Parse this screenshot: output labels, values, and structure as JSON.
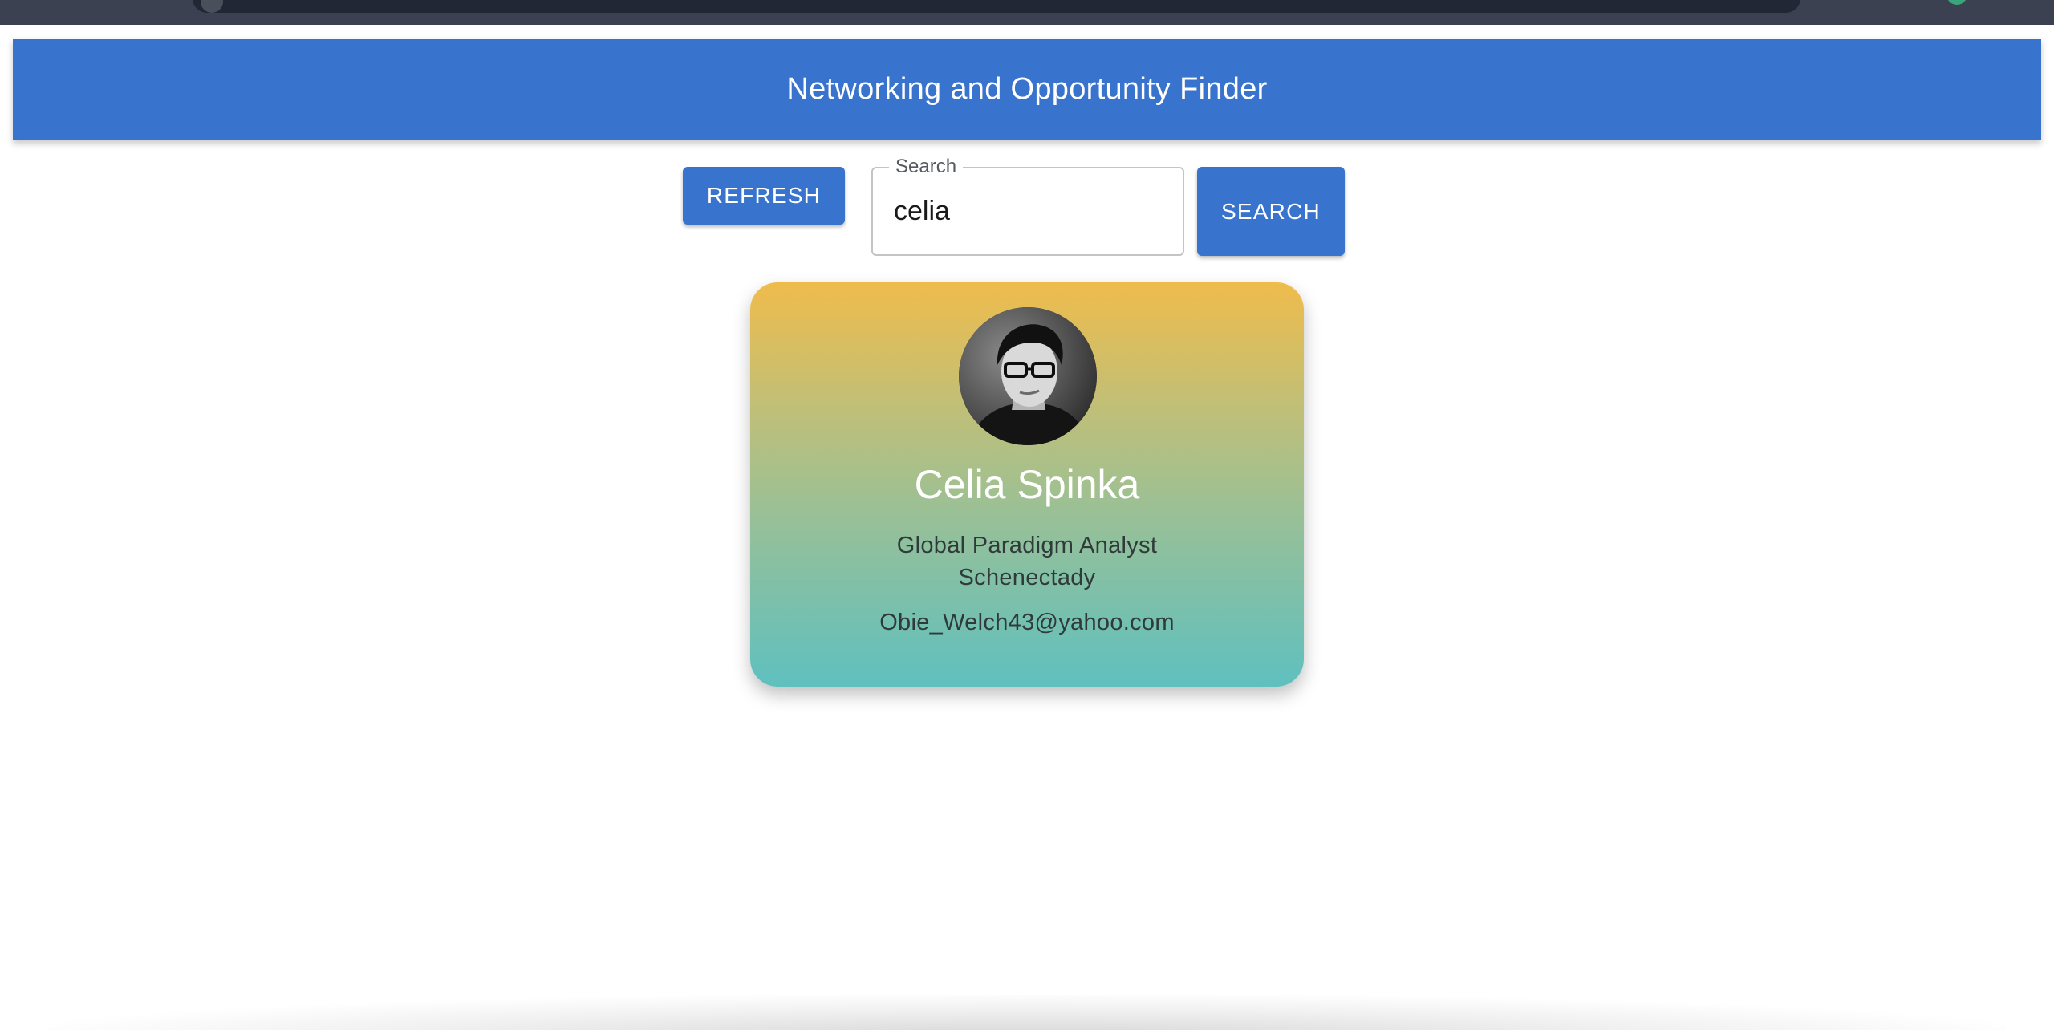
{
  "app": {
    "title": "Networking and Opportunity Finder"
  },
  "controls": {
    "refresh_label": "REFRESH",
    "search_label": "SEARCH",
    "search_field": {
      "label": "Search",
      "value": "celia"
    }
  },
  "results": [
    {
      "name": "Celia Spinka",
      "job_title": "Global Paradigm Analyst",
      "city": "Schenectady",
      "email": "Obie_Welch43@yahoo.com",
      "avatar_icon": "person-photo"
    }
  ],
  "colors": {
    "primary": "#3873ce",
    "card_gradient_top": "#efbc4c",
    "card_gradient_bottom": "#5fc0bf"
  }
}
